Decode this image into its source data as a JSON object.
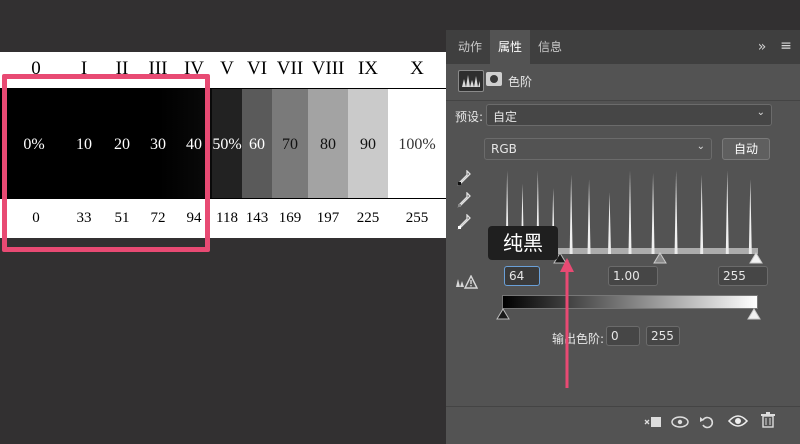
{
  "zone_chart": {
    "roman": [
      "0",
      "I",
      "II",
      "III",
      "IV",
      "V",
      "VI",
      "VII",
      "VIII",
      "IX",
      "X"
    ],
    "percent": [
      "0%",
      "10",
      "20",
      "30",
      "40",
      "50%",
      "60",
      "70",
      "80",
      "90",
      "100%"
    ],
    "values": [
      "0",
      "33",
      "51",
      "72",
      "94",
      "118",
      "143",
      "169",
      "197",
      "225",
      "255"
    ],
    "fills": [
      "#000000",
      "#000000",
      "#000000",
      "#000000",
      "#000000",
      "#222222",
      "#5a5a5a",
      "#7a7a7a",
      "#a3a3a3",
      "#cacaca",
      "#ffffff"
    ]
  },
  "panel": {
    "tabs": [
      "动作",
      "属性",
      "信息"
    ],
    "active_tab": "属性",
    "collapse_glyph": "»",
    "menu_glyph": "≡",
    "adjustment_title": "色阶",
    "preset_label": "预设:",
    "preset_value": "自定",
    "channel_value": "RGB",
    "auto_button": "自动",
    "input_black": "64",
    "input_gamma": "1.00",
    "input_white": "255",
    "output_label": "输出色阶:",
    "output_black": "0",
    "output_white": "255"
  },
  "annotation": {
    "tooltip": "纯黑",
    "highlight_color": "#e84a73"
  },
  "histogram_peaks": [
    {
      "x": 0.02,
      "h": 0.95
    },
    {
      "x": 0.08,
      "h": 0.8
    },
    {
      "x": 0.14,
      "h": 0.95
    },
    {
      "x": 0.2,
      "h": 0.75
    },
    {
      "x": 0.27,
      "h": 0.9
    },
    {
      "x": 0.34,
      "h": 0.85
    },
    {
      "x": 0.42,
      "h": 0.7
    },
    {
      "x": 0.5,
      "h": 0.95
    },
    {
      "x": 0.59,
      "h": 0.92
    },
    {
      "x": 0.68,
      "h": 0.95
    },
    {
      "x": 0.78,
      "h": 0.9
    },
    {
      "x": 0.88,
      "h": 0.95
    },
    {
      "x": 0.97,
      "h": 0.85
    }
  ]
}
